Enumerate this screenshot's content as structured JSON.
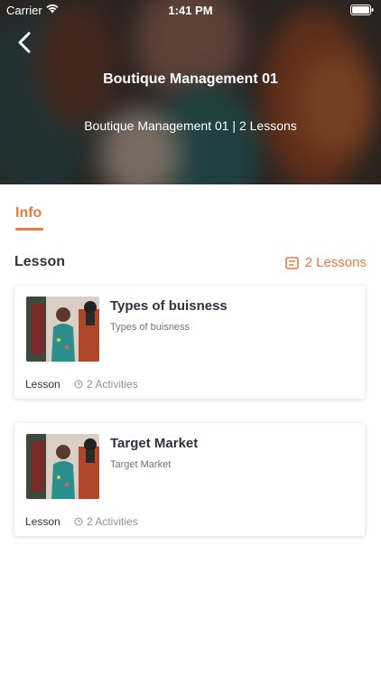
{
  "status": {
    "carrier": "Carrier",
    "time": "1:41 PM"
  },
  "header": {
    "title": "Boutique Management 01",
    "subtitle": "Boutique Management 01 | 2 Lessons"
  },
  "tabs": [
    {
      "label": "Info",
      "active": true
    }
  ],
  "section": {
    "title": "Lesson",
    "count_label": "2 Lessons"
  },
  "lessons": [
    {
      "title": "Types of buisness",
      "description": "Types of buisness",
      "type": "Lesson",
      "activities": "2 Activities"
    },
    {
      "title": "Target Market",
      "description": "Target Market",
      "type": "Lesson",
      "activities": "2 Activities"
    }
  ],
  "colors": {
    "accent": "#e8793f",
    "text": "#2d3440",
    "muted": "#8a929c"
  }
}
